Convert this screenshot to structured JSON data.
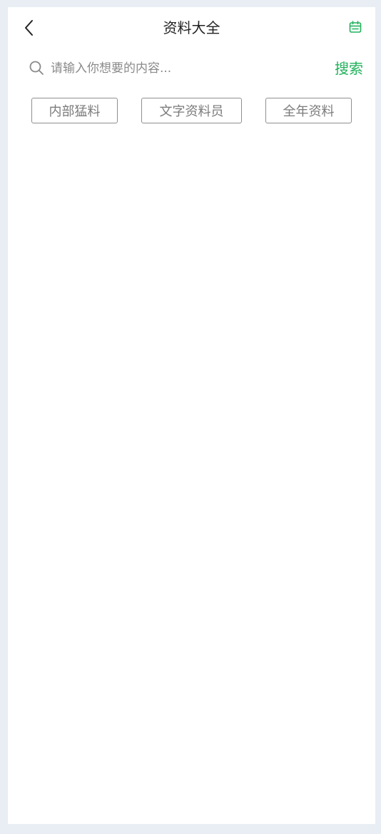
{
  "header": {
    "title": "资料大全",
    "back_icon": "chevron-left-icon",
    "calendar_icon": "calendar-icon",
    "accent_color": "#21b25b"
  },
  "search": {
    "placeholder": "请输入你想要的内容...",
    "value": "",
    "button_label": "搜索",
    "icon": "search-icon"
  },
  "tags": [
    {
      "label": "内部猛料"
    },
    {
      "label": "文字资料员"
    },
    {
      "label": "全年资料"
    }
  ]
}
